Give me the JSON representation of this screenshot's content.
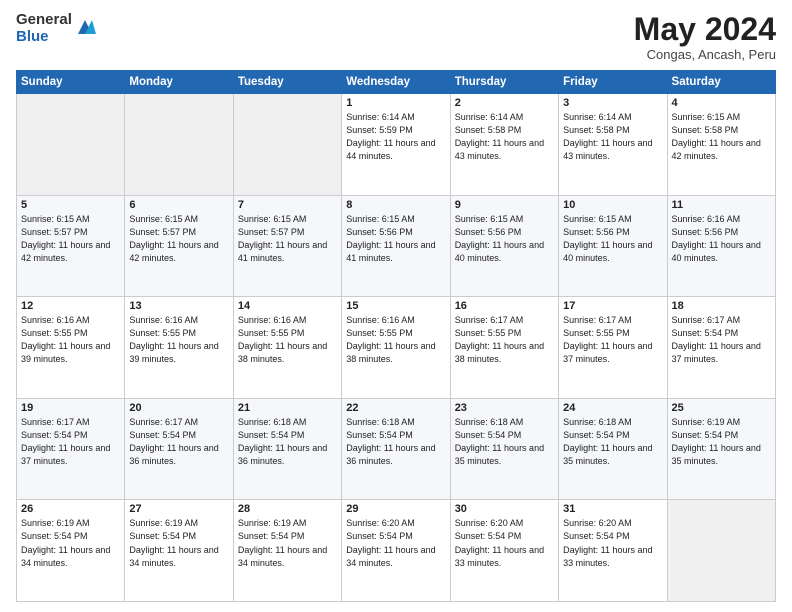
{
  "logo": {
    "general": "General",
    "blue": "Blue"
  },
  "header": {
    "month_year": "May 2024",
    "location": "Congas, Ancash, Peru"
  },
  "days_of_week": [
    "Sunday",
    "Monday",
    "Tuesday",
    "Wednesday",
    "Thursday",
    "Friday",
    "Saturday"
  ],
  "weeks": [
    [
      {
        "day": "",
        "info": ""
      },
      {
        "day": "",
        "info": ""
      },
      {
        "day": "",
        "info": ""
      },
      {
        "day": "1",
        "info": "Sunrise: 6:14 AM\nSunset: 5:59 PM\nDaylight: 11 hours\nand 44 minutes."
      },
      {
        "day": "2",
        "info": "Sunrise: 6:14 AM\nSunset: 5:58 PM\nDaylight: 11 hours\nand 43 minutes."
      },
      {
        "day": "3",
        "info": "Sunrise: 6:14 AM\nSunset: 5:58 PM\nDaylight: 11 hours\nand 43 minutes."
      },
      {
        "day": "4",
        "info": "Sunrise: 6:15 AM\nSunset: 5:58 PM\nDaylight: 11 hours\nand 42 minutes."
      }
    ],
    [
      {
        "day": "5",
        "info": "Sunrise: 6:15 AM\nSunset: 5:57 PM\nDaylight: 11 hours\nand 42 minutes."
      },
      {
        "day": "6",
        "info": "Sunrise: 6:15 AM\nSunset: 5:57 PM\nDaylight: 11 hours\nand 42 minutes."
      },
      {
        "day": "7",
        "info": "Sunrise: 6:15 AM\nSunset: 5:57 PM\nDaylight: 11 hours\nand 41 minutes."
      },
      {
        "day": "8",
        "info": "Sunrise: 6:15 AM\nSunset: 5:56 PM\nDaylight: 11 hours\nand 41 minutes."
      },
      {
        "day": "9",
        "info": "Sunrise: 6:15 AM\nSunset: 5:56 PM\nDaylight: 11 hours\nand 40 minutes."
      },
      {
        "day": "10",
        "info": "Sunrise: 6:15 AM\nSunset: 5:56 PM\nDaylight: 11 hours\nand 40 minutes."
      },
      {
        "day": "11",
        "info": "Sunrise: 6:16 AM\nSunset: 5:56 PM\nDaylight: 11 hours\nand 40 minutes."
      }
    ],
    [
      {
        "day": "12",
        "info": "Sunrise: 6:16 AM\nSunset: 5:55 PM\nDaylight: 11 hours\nand 39 minutes."
      },
      {
        "day": "13",
        "info": "Sunrise: 6:16 AM\nSunset: 5:55 PM\nDaylight: 11 hours\nand 39 minutes."
      },
      {
        "day": "14",
        "info": "Sunrise: 6:16 AM\nSunset: 5:55 PM\nDaylight: 11 hours\nand 38 minutes."
      },
      {
        "day": "15",
        "info": "Sunrise: 6:16 AM\nSunset: 5:55 PM\nDaylight: 11 hours\nand 38 minutes."
      },
      {
        "day": "16",
        "info": "Sunrise: 6:17 AM\nSunset: 5:55 PM\nDaylight: 11 hours\nand 38 minutes."
      },
      {
        "day": "17",
        "info": "Sunrise: 6:17 AM\nSunset: 5:55 PM\nDaylight: 11 hours\nand 37 minutes."
      },
      {
        "day": "18",
        "info": "Sunrise: 6:17 AM\nSunset: 5:54 PM\nDaylight: 11 hours\nand 37 minutes."
      }
    ],
    [
      {
        "day": "19",
        "info": "Sunrise: 6:17 AM\nSunset: 5:54 PM\nDaylight: 11 hours\nand 37 minutes."
      },
      {
        "day": "20",
        "info": "Sunrise: 6:17 AM\nSunset: 5:54 PM\nDaylight: 11 hours\nand 36 minutes."
      },
      {
        "day": "21",
        "info": "Sunrise: 6:18 AM\nSunset: 5:54 PM\nDaylight: 11 hours\nand 36 minutes."
      },
      {
        "day": "22",
        "info": "Sunrise: 6:18 AM\nSunset: 5:54 PM\nDaylight: 11 hours\nand 36 minutes."
      },
      {
        "day": "23",
        "info": "Sunrise: 6:18 AM\nSunset: 5:54 PM\nDaylight: 11 hours\nand 35 minutes."
      },
      {
        "day": "24",
        "info": "Sunrise: 6:18 AM\nSunset: 5:54 PM\nDaylight: 11 hours\nand 35 minutes."
      },
      {
        "day": "25",
        "info": "Sunrise: 6:19 AM\nSunset: 5:54 PM\nDaylight: 11 hours\nand 35 minutes."
      }
    ],
    [
      {
        "day": "26",
        "info": "Sunrise: 6:19 AM\nSunset: 5:54 PM\nDaylight: 11 hours\nand 34 minutes."
      },
      {
        "day": "27",
        "info": "Sunrise: 6:19 AM\nSunset: 5:54 PM\nDaylight: 11 hours\nand 34 minutes."
      },
      {
        "day": "28",
        "info": "Sunrise: 6:19 AM\nSunset: 5:54 PM\nDaylight: 11 hours\nand 34 minutes."
      },
      {
        "day": "29",
        "info": "Sunrise: 6:20 AM\nSunset: 5:54 PM\nDaylight: 11 hours\nand 34 minutes."
      },
      {
        "day": "30",
        "info": "Sunrise: 6:20 AM\nSunset: 5:54 PM\nDaylight: 11 hours\nand 33 minutes."
      },
      {
        "day": "31",
        "info": "Sunrise: 6:20 AM\nSunset: 5:54 PM\nDaylight: 11 hours\nand 33 minutes."
      },
      {
        "day": "",
        "info": ""
      }
    ]
  ]
}
